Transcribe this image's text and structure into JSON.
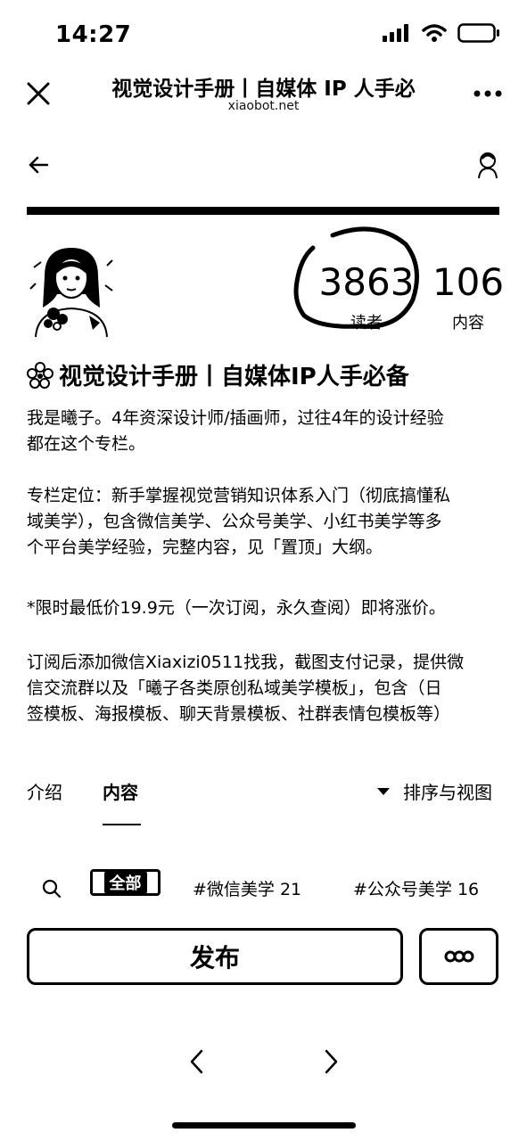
{
  "status_bar": {
    "time": "14:27"
  },
  "browser": {
    "title": "视觉设计手册丨自媒体 IP 人手必",
    "url": "xiaobot.net"
  },
  "profile": {
    "readers_count": "3863",
    "readers_label": "读者",
    "contents_count": "106",
    "contents_label": "内容"
  },
  "column": {
    "title": "视觉设计手册丨自媒体IP人手必备",
    "paragraphs": [
      [
        "我是曦子。4年资深设计师/插画师，过往4年的设计经验",
        "都在这个专栏。"
      ],
      [
        "专栏定位：新手掌握视觉营销知识体系入门（彻底搞懂私",
        "域美学），包含微信美学、公众号美学、小红书美学等多",
        "个平台美学经验，完整内容，见「置顶」大纲。"
      ],
      [
        "*限时最低价19.9元（一次订阅，永久查阅）即将涨价。"
      ],
      [
        "订阅后添加微信Xiaxizi0511找我，截图支付记录，提供微",
        "信交流群以及「曦子各类原创私域美学模板」，包含（日",
        "签模板、海报模板、聊天背景模板、社群表情包模板等）"
      ]
    ]
  },
  "tabs": {
    "intro": "介绍",
    "content": "内容",
    "sort": "排序与视图"
  },
  "filters": {
    "all": "全部",
    "tags": [
      {
        "label": "#微信美学 21"
      },
      {
        "label": "#公众号美学 16"
      }
    ]
  },
  "actions": {
    "publish": "发布"
  }
}
